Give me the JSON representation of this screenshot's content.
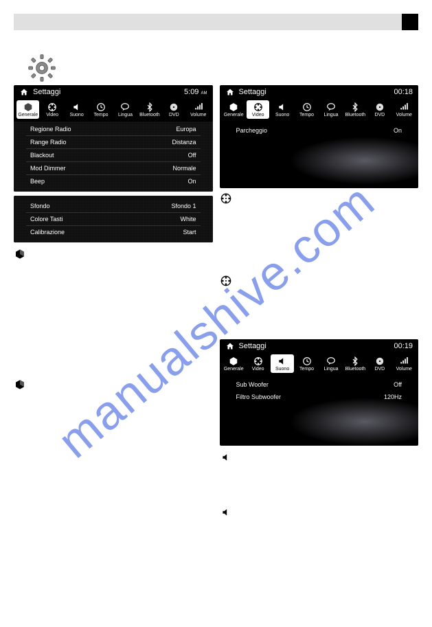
{
  "watermark": "manualshive.com",
  "screen1": {
    "title": "Settaggi",
    "time": "5:09",
    "ampm": "AM",
    "tabs": [
      "Generale",
      "Video",
      "Suono",
      "Tempo",
      "Lingua",
      "Bluetooth",
      "DVD",
      "Volume"
    ],
    "active_tab": 0,
    "rows": [
      {
        "label": "Regione Radio",
        "value": "Europa"
      },
      {
        "label": "Range Radio",
        "value": "Distanza"
      },
      {
        "label": "Blackout",
        "value": "Off"
      },
      {
        "label": "Mod Dimmer",
        "value": "Normale"
      },
      {
        "label": "Beep",
        "value": "On"
      }
    ]
  },
  "screen1b": {
    "rows": [
      {
        "label": "Sfondo",
        "value": "Sfondo 1"
      },
      {
        "label": "Colore Tasti",
        "value": "White"
      },
      {
        "label": "Calibrazione",
        "value": "Start"
      }
    ]
  },
  "screen2": {
    "title": "Settaggi",
    "time": "00:18",
    "tabs": [
      "Generale",
      "Video",
      "Suono",
      "Tempo",
      "Lingua",
      "Bluetooth",
      "DVD",
      "Volume"
    ],
    "active_tab": 1,
    "rows": [
      {
        "label": "Parcheggio",
        "value": "On"
      }
    ]
  },
  "screen3": {
    "title": "Settaggi",
    "time": "00:19",
    "tabs": [
      "Generale",
      "Video",
      "Suono",
      "Tempo",
      "Lingua",
      "Bluetooth",
      "DVD",
      "Volume"
    ],
    "active_tab": 2,
    "rows": [
      {
        "label": "Sub Woofer",
        "value": "Off"
      },
      {
        "label": "Filtro Subwoofer",
        "value": "120Hz"
      }
    ]
  },
  "icon_labels": {
    "cube": "cube-icon",
    "reel": "film-reel-icon",
    "speaker": "speaker-icon"
  }
}
